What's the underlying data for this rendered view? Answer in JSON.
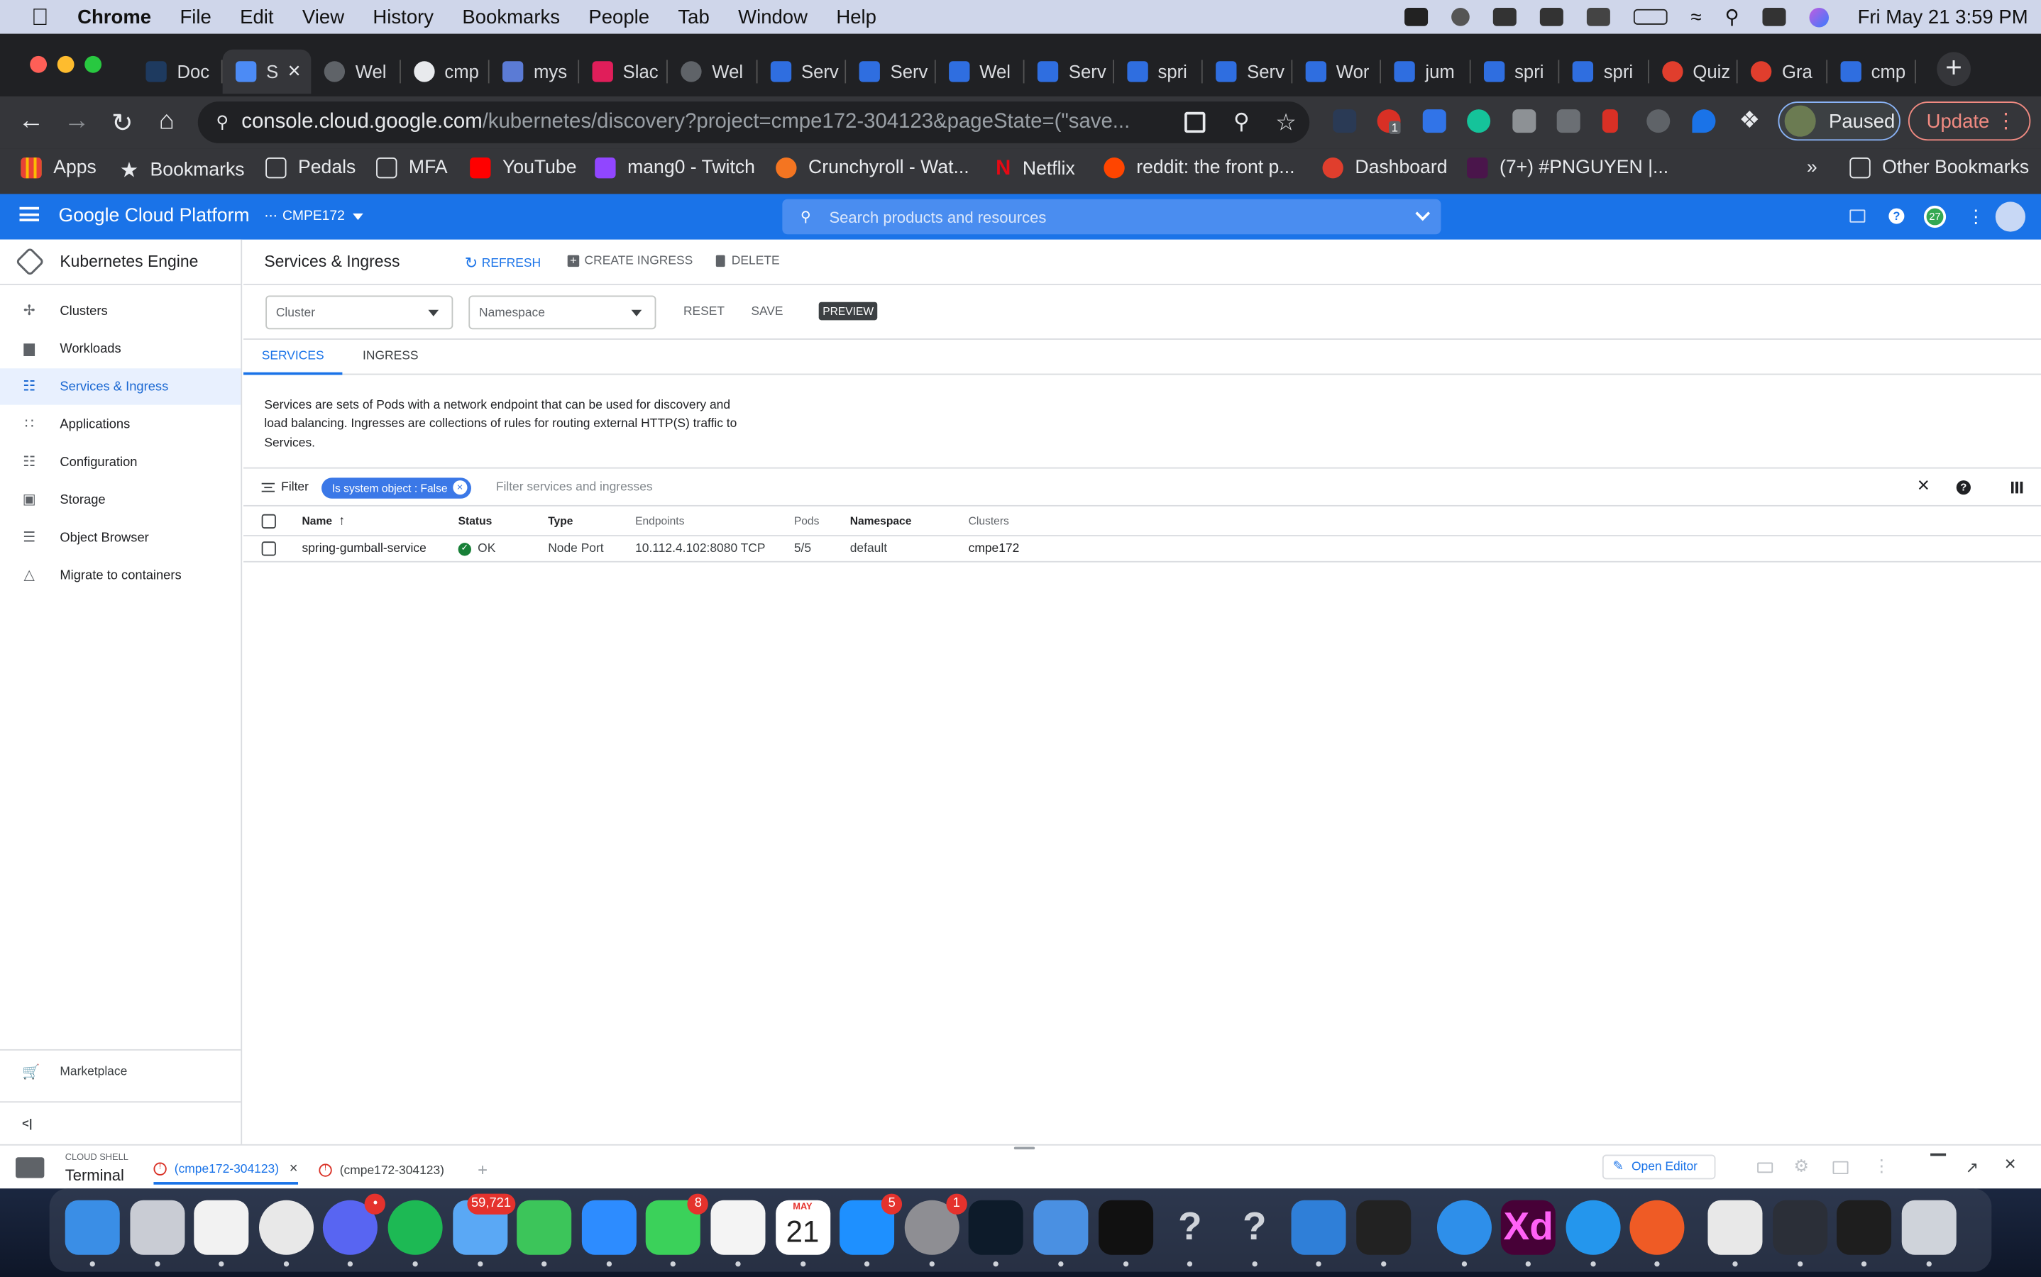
{
  "menubar": {
    "app_name": "Chrome",
    "items": [
      "File",
      "Edit",
      "View",
      "History",
      "Bookmarks",
      "People",
      "Tab",
      "Window",
      "Help"
    ],
    "date_time": "Fri May 21  3:59 PM"
  },
  "browser": {
    "tabs": [
      {
        "label": "Doc",
        "icon": "doc-icon"
      },
      {
        "label": "S",
        "icon": "gcp-icon",
        "active": true
      },
      {
        "label": "Wel",
        "icon": "globe-icon"
      },
      {
        "label": "cmp",
        "icon": "github-icon"
      },
      {
        "label": "mys",
        "icon": "stack-icon"
      },
      {
        "label": "Slac",
        "icon": "slack-icon"
      },
      {
        "label": "Wel",
        "icon": "globe-icon"
      },
      {
        "label": "Serv",
        "icon": "kube-icon"
      },
      {
        "label": "Serv",
        "icon": "kube-icon"
      },
      {
        "label": "Wel",
        "icon": "kube-icon"
      },
      {
        "label": "Serv",
        "icon": "kube-icon"
      },
      {
        "label": "spri",
        "icon": "kube-icon"
      },
      {
        "label": "Serv",
        "icon": "kube-icon"
      },
      {
        "label": "Wor",
        "icon": "kube-icon"
      },
      {
        "label": "jum",
        "icon": "kube-icon"
      },
      {
        "label": "spri",
        "icon": "kube-icon"
      },
      {
        "label": "spri",
        "icon": "kube-icon"
      },
      {
        "label": "Quiz",
        "icon": "canvas-icon"
      },
      {
        "label": "Gra",
        "icon": "canvas-icon"
      },
      {
        "label": "cmp",
        "icon": "kube-icon"
      }
    ],
    "url_host": "console.cloud.google.com",
    "url_path": "/kubernetes/discovery?project=cmpe172-304123&pageState=(\"save...",
    "profile_label": "Paused",
    "update_label": "Update",
    "bookmarks": [
      "Apps",
      "Bookmarks",
      "Pedals",
      "MFA",
      "YouTube",
      "mang0 - Twitch",
      "Crunchyroll - Wat...",
      "Netflix",
      "reddit: the front p...",
      "Dashboard",
      "(7+) #PNGUYEN |..."
    ],
    "bookmarks_overflow": "»",
    "other_bookmarks": "Other Bookmarks",
    "extension_badge": "1"
  },
  "gcp": {
    "brand": "Google Cloud Platform",
    "project": "CMPE172",
    "search_placeholder": "Search products and resources",
    "notification_count": "27"
  },
  "sidebar": {
    "product": "Kubernetes Engine",
    "items": [
      {
        "label": "Clusters",
        "icon": "clusters-icon"
      },
      {
        "label": "Workloads",
        "icon": "workloads-icon"
      },
      {
        "label": "Services & Ingress",
        "icon": "services-icon",
        "active": true
      },
      {
        "label": "Applications",
        "icon": "applications-icon"
      },
      {
        "label": "Configuration",
        "icon": "configuration-icon"
      },
      {
        "label": "Storage",
        "icon": "storage-icon"
      },
      {
        "label": "Object Browser",
        "icon": "object-browser-icon"
      },
      {
        "label": "Migrate to containers",
        "icon": "migrate-icon"
      }
    ],
    "marketplace": "Marketplace",
    "collapse": "<|"
  },
  "page": {
    "title": "Services & Ingress",
    "refresh": "REFRESH",
    "create_ingress": "CREATE INGRESS",
    "delete": "DELETE",
    "cluster_placeholder": "Cluster",
    "namespace_placeholder": "Namespace",
    "reset": "RESET",
    "save": "SAVE",
    "preview": "PREVIEW",
    "tabs": [
      "SERVICES",
      "INGRESS"
    ],
    "description_lines": [
      "Services are sets of Pods with a network endpoint that can be used for discovery and",
      "load balancing. Ingresses are collections of rules for routing external HTTP(S) traffic to",
      "Services."
    ],
    "filter_label": "Filter",
    "filter_chip": "Is system object : False",
    "filter_placeholder": "Filter services and ingresses",
    "columns": [
      "Name",
      "Status",
      "Type",
      "Endpoints",
      "Pods",
      "Namespace",
      "Clusters"
    ],
    "rows": [
      {
        "name": "spring-gumball-service",
        "status": "OK",
        "type": "Node Port",
        "endpoints": "10.112.4.102:8080 TCP",
        "pods": "5/5",
        "namespace": "default",
        "clusters": "cmpe172"
      }
    ]
  },
  "cloud_shell": {
    "caption": "CLOUD SHELL",
    "title": "Terminal",
    "tabs": [
      "(cmpe172-304123)",
      "(cmpe172-304123)"
    ],
    "add_tab": "+",
    "open_editor": "Open Editor"
  },
  "dock": {
    "apps": [
      {
        "name": "finder-icon",
        "color": "#3a8ee6"
      },
      {
        "name": "launchpad-icon",
        "color": "#c9ccd4"
      },
      {
        "name": "paw-icon",
        "color": "#f2f2f2"
      },
      {
        "name": "chrome-icon",
        "color": "#e8e8e8"
      },
      {
        "name": "discord-icon",
        "color": "#5865f2",
        "badge": "•"
      },
      {
        "name": "spotify-icon",
        "color": "#1db954"
      },
      {
        "name": "mail-icon",
        "color": "#5aa8f5",
        "badge": "59,721"
      },
      {
        "name": "facetime-icon",
        "color": "#3cc55a"
      },
      {
        "name": "zoom-icon",
        "color": "#2d8cff"
      },
      {
        "name": "messages-icon",
        "color": "#3bd15a",
        "badge": "8"
      },
      {
        "name": "photos-icon",
        "color": "#f4f4f4"
      },
      {
        "name": "calendar-icon",
        "color": "#ffffff",
        "month": "MAY",
        "day": "21"
      },
      {
        "name": "app-store-icon",
        "color": "#1e90ff",
        "badge": "5"
      },
      {
        "name": "system-preferences-icon",
        "color": "#8e8e93",
        "badge": "1"
      },
      {
        "name": "vscode-icon",
        "color": "#0d1b2a"
      },
      {
        "name": "xcode-icon",
        "color": "#4a90e2"
      },
      {
        "name": "terminal-icon",
        "color": "#111"
      },
      {
        "name": "unknown-app-icon",
        "color": "transparent",
        "glyph": "?"
      },
      {
        "name": "unknown-app-icon",
        "color": "transparent",
        "glyph": "?"
      },
      {
        "name": "fork-icon",
        "color": "#2f7fd8"
      },
      {
        "name": "audio-meter-icon",
        "color": "#222"
      },
      {
        "name": "safari-icon",
        "color": "#2e8fea"
      },
      {
        "name": "adobe-xd-icon",
        "color": "#470137",
        "glyph": "Xd"
      },
      {
        "name": "docker-icon",
        "color": "#2496ed"
      },
      {
        "name": "postman-icon",
        "color": "#ef5b25"
      },
      {
        "name": "zip-file-icon",
        "color": "#e8e8e8"
      },
      {
        "name": "screenshot-stack-icon",
        "color": "#2b2f38"
      },
      {
        "name": "vscode-window-icon",
        "color": "#1e1e1e"
      },
      {
        "name": "trash-icon",
        "color": "#cfd3da"
      }
    ]
  }
}
